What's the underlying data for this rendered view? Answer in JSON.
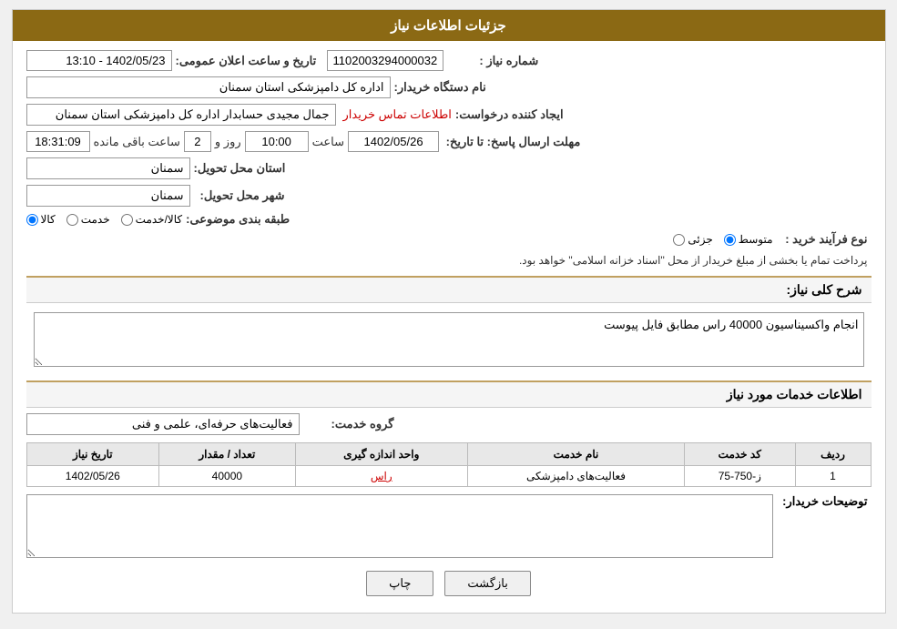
{
  "page": {
    "header": "جزئیات اطلاعات نیاز",
    "sections": {
      "main_info": {
        "need_number_label": "شماره نیاز :",
        "need_number_value": "1102003294000032",
        "date_announce_label": "تاریخ و ساعت اعلان عمومی:",
        "date_announce_value": "1402/05/23 - 13:10",
        "buyer_org_label": "نام دستگاه خریدار:",
        "buyer_org_value": "اداره کل دامپزشکی استان سمنان",
        "creator_label": "ایجاد کننده درخواست:",
        "creator_value": "جمال مجیدی حسابدار اداره کل دامپزشکی استان سمنان",
        "contact_link": "اطلاعات تماس خریدار",
        "deadline_label": "مهلت ارسال پاسخ: تا تاریخ:",
        "deadline_date": "1402/05/26",
        "deadline_time_label": "ساعت",
        "deadline_time": "10:00",
        "deadline_day_label": "روز و",
        "deadline_days": "2",
        "deadline_remaining_label": "ساعت باقی مانده",
        "deadline_remaining": "18:31:09",
        "province_delivery_label": "استان محل تحویل:",
        "province_delivery_value": "سمنان",
        "city_delivery_label": "شهر محل تحویل:",
        "city_delivery_value": "سمنان",
        "category_label": "طبقه بندی موضوعی:",
        "category_options": [
          "کالا",
          "خدمت",
          "کالا/خدمت"
        ],
        "category_selected": "کالا",
        "process_label": "نوع فرآیند خرید :",
        "process_options": [
          "جزئی",
          "متوسط"
        ],
        "process_selected": "متوسط",
        "process_desc": "پرداخت تمام یا بخشی از مبلغ خریدار از محل \"اسناد خزانه اسلامی\" خواهد بود."
      },
      "need_description": {
        "title": "شرح کلی نیاز:",
        "value": "انجام واکسیناسیون 40000 راس مطابق فایل پیوست"
      },
      "services_info": {
        "title": "اطلاعات خدمات مورد نیاز",
        "group_service_label": "گروه خدمت:",
        "group_service_value": "فعالیت‌های حرفه‌ای، علمی و فنی",
        "table": {
          "columns": [
            "ردیف",
            "کد خدمت",
            "نام خدمت",
            "واحد اندازه گیری",
            "تعداد / مقدار",
            "تاریخ نیاز"
          ],
          "rows": [
            {
              "row_num": "1",
              "service_code": "ز-750-75",
              "service_name": "فعالیت‌های دامپزشکی",
              "unit": "راس",
              "quantity": "40000",
              "date": "1402/05/26"
            }
          ]
        }
      },
      "buyer_desc": {
        "label": "توضیحات خریدار:",
        "value": ""
      }
    },
    "buttons": {
      "back": "بازگشت",
      "print": "چاپ"
    }
  }
}
